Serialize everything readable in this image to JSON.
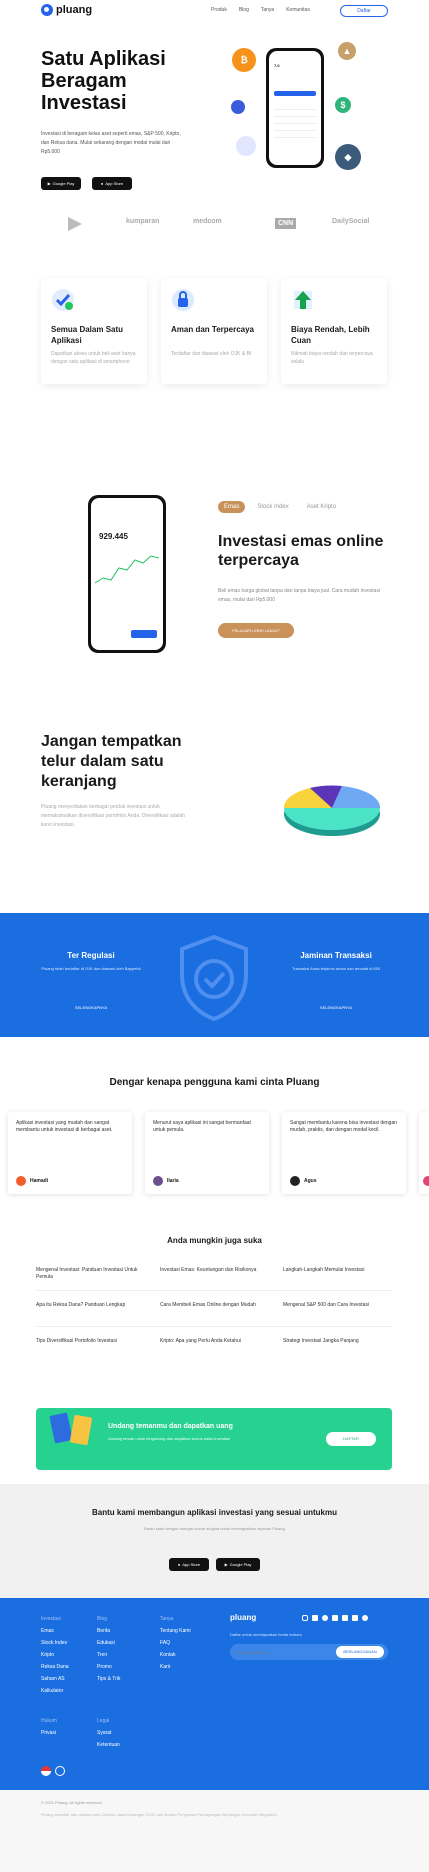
{
  "nav": {
    "logo": "pluang",
    "links": [
      "Produk",
      "Blog",
      "Tanya",
      "Komunitas"
    ],
    "cta": "Daftar"
  },
  "hero": {
    "title": "Satu Aplikasi Beragam Investasi",
    "subtitle": "Investasi di beragam kelas aset seperti emas, S&P 500, Kripto, dan Reksa dana. Mulai sekarang dengan modal mulai dari Rp5.000",
    "google_play": "Google Play",
    "app_store": "App Store",
    "phone_balance": "7,0"
  },
  "press": [
    "kumparan",
    "medcom",
    "CNN",
    "DailySocial"
  ],
  "features": [
    {
      "title": "Semua Dalam Satu Aplikasi",
      "desc": "Dapatkan akses untuk beli aset hanya dengan satu aplikasi di smartphone"
    },
    {
      "title": "Aman dan Terpercaya",
      "desc": "Terdaftar dan diawasi oleh OJK & BI"
    },
    {
      "title": "Biaya Rendah, Lebih Cuan",
      "desc": "Nikmati biaya rendah dan terpercaya selalu"
    }
  ],
  "product": {
    "tabs": [
      "Emas",
      "Stock Index",
      "Aset Kripto"
    ],
    "title": "Investasi emas online terpercaya",
    "desc": "Beli emas harga global tanpa dan tanpa biaya jual. Cara mudah investasi emas, mulai dari Rp5.000",
    "button": "PELAJARI LEBIH LANJUT",
    "phone_value": "929.445"
  },
  "diversify": {
    "title": "Jangan tempatkan telur dalam satu keranjang",
    "desc": "Pluang menyediakan berbagai produk investasi untuk memaksimalkan diversifikasi portofolio Anda. Diversifikasi adalah kunci investasi."
  },
  "trust": {
    "left_title": "Ter Regulasi",
    "left_desc": "Pluang telah terdaftar di OJK dan diawasi oleh Bappebti",
    "left_link": "SELENGKAPNYA",
    "right_title": "Jaminan Transaksi",
    "right_desc": "Transaksi Anda terjamin aman dan tercatat di KBI",
    "right_link": "SELENGKAPNYA"
  },
  "testimonials": {
    "heading": "Dengar kenapa pengguna kami cinta Pluang",
    "items": [
      {
        "quote": "Aplikasi investasi yang mudah dan sangat membantu untuk investasi di berbagai aset.",
        "name": "Hamadi",
        "color": "#f25b2a"
      },
      {
        "quote": "Menurut saya aplikasi ini sangat bermanfaat untuk pemula.",
        "name": "Ilaria",
        "color": "#6b4f8f"
      },
      {
        "quote": "Sangat membantu karena bisa investasi dengan mudah, praktis, dan dengan modal kecil.",
        "name": "Agus",
        "color": "#222222"
      }
    ]
  },
  "articles": {
    "heading": "Anda mungkin juga suka",
    "items": [
      "Mengenal Investasi: Panduan Investasi Untuk Pemula",
      "Investasi Emas: Keuntungan dan Risikonya",
      "Langkah-Langkah Memulai Investasi",
      "Apa itu Reksa Dana? Panduan Lengkap",
      "Cara Membeli Emas Online dengan Mudah",
      "Mengenal S&P 500 dan Cara Investasi",
      "Tips Diversifikasi Portofolio Investasi",
      "Kripto: Apa yang Perlu Anda Ketahui",
      "Strategi Investasi Jangka Panjang"
    ]
  },
  "promo": {
    "title": "Undang temanmu dan dapatkan uang",
    "desc": "Undang teman untuk bergabung dan dapatkan bonus saldo investasi",
    "button": "DAFTAR"
  },
  "survey": {
    "title": "Bantu kami membangun aplikasi investasi yang sesuai untukmu",
    "desc": "Bantu kami dengan mengisi survei singkat untuk meningkatkan layanan Pluang."
  },
  "footer": {
    "logo": "pluang",
    "col1_head": "Investasi",
    "col1": [
      "Emas",
      "Stock Index",
      "Kripto",
      "Reksa Dana",
      "Saham AS",
      "Kalkulator"
    ],
    "col2_head": "Blog",
    "col2": [
      "Berita",
      "Edukasi",
      "Tren",
      "Promo",
      "Tips & Trik"
    ],
    "col3_head": "Tanya",
    "col3": [
      "Tentang Kami",
      "FAQ",
      "Kontak",
      "Karir"
    ],
    "col4_head": "Hukum",
    "col4": [
      "Privasi"
    ],
    "col5_head": "Legal",
    "col5": [
      "Syarat",
      "Ketentuan"
    ],
    "newsletter_label": "Daftar untuk mendapatkan berita terbaru",
    "email_placeholder": "nama@email.com",
    "subscribe": "BERLANGGANAN",
    "copyright": "© 2021 Pluang. All rights reserved.",
    "disclaimer": "Pluang terdaftar dan diawasi oleh Otoritas Jasa Keuangan (OJK) dan Badan Pengawas Perdagangan Berjangka Komoditi (Bappebti)."
  }
}
